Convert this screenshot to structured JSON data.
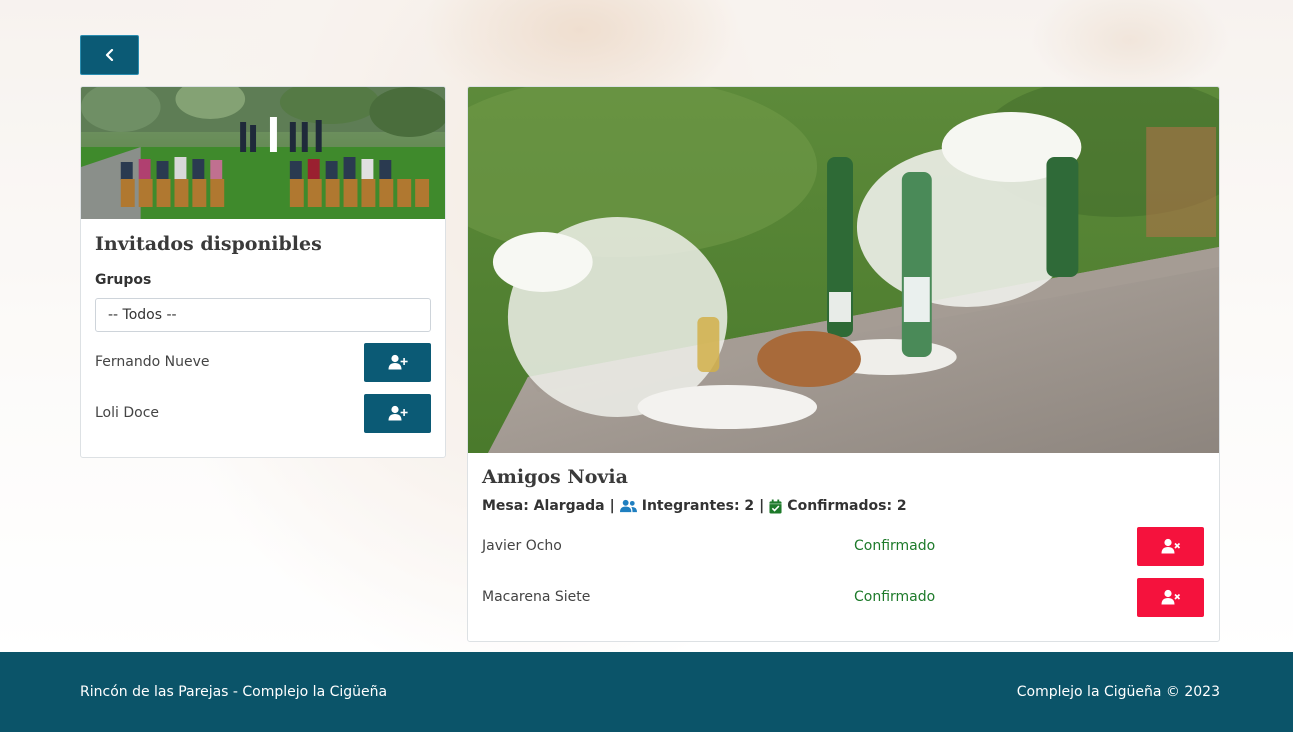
{
  "nav": {
    "back_icon": "chevron-left-icon"
  },
  "available": {
    "title": "Invitados disponibles",
    "groups_label": "Grupos",
    "groups_selected": "-- Todos --",
    "guests": [
      {
        "name": "Fernando Nueve",
        "action_icon": "user-plus-icon"
      },
      {
        "name": "Loli Doce",
        "action_icon": "user-plus-icon"
      }
    ]
  },
  "table": {
    "title": "Amigos Novia",
    "mesa_label": "Mesa: Alargada",
    "separator": "|",
    "members_label": "Integrantes: 2",
    "confirmed_label": "Confirmados: 2",
    "members": [
      {
        "name": "Javier Ocho",
        "status": "Confirmado",
        "action_icon": "user-xmark-icon"
      },
      {
        "name": "Macarena Siete",
        "status": "Confirmado",
        "action_icon": "user-xmark-icon"
      }
    ]
  },
  "footer": {
    "left": "Rincón de las Parejas - Complejo la Cigüeña",
    "right": "Complejo la Cigüeña © 2023"
  },
  "colors": {
    "primary": "#0b5a75",
    "danger": "#f5123d",
    "success": "#1d7a2a",
    "footer": "#0b5469",
    "users_icon": "#1f7fc0",
    "calendar_icon": "#1d7a2a"
  }
}
